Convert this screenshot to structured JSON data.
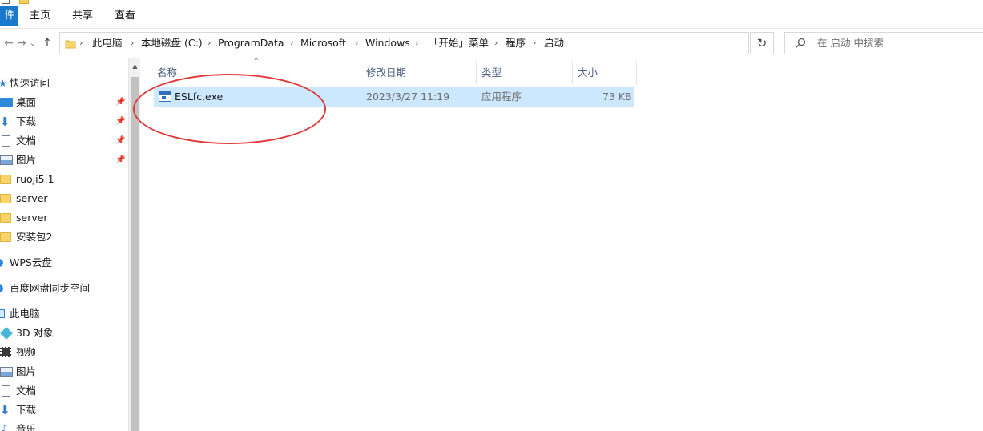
{
  "ribbon": {
    "tabs": [
      {
        "label": "件"
      },
      {
        "label": "主页"
      },
      {
        "label": "共享"
      },
      {
        "label": "查看"
      }
    ]
  },
  "nav_buttons": {
    "back": "←",
    "forward": "→",
    "recent": "⌄",
    "up": "↑"
  },
  "address": {
    "crumbs": [
      "此电脑",
      "本地磁盘 (C:)",
      "ProgramData",
      "Microsoft",
      "Windows",
      "「开始」菜单",
      "程序",
      "启动"
    ],
    "separator": "›",
    "dropdown": "⌄"
  },
  "refresh": "↻",
  "search": {
    "placeholder": "在 启动 中搜索"
  },
  "nav_pane": {
    "items": [
      {
        "label": "快速访问",
        "icon": "star-icon",
        "pinned": false
      },
      {
        "label": "桌面",
        "icon": "desktop-icon",
        "pinned": true
      },
      {
        "label": "下载",
        "icon": "download-icon",
        "pinned": true
      },
      {
        "label": "文档",
        "icon": "document-icon",
        "pinned": true
      },
      {
        "label": "图片",
        "icon": "picture-icon",
        "pinned": true
      },
      {
        "label": "ruoji5.1",
        "icon": "folder-icon",
        "pinned": false
      },
      {
        "label": "server",
        "icon": "folder-icon",
        "pinned": false
      },
      {
        "label": "server",
        "icon": "folder-icon",
        "pinned": false
      },
      {
        "label": "安装包2",
        "icon": "folder-icon",
        "pinned": false
      },
      {
        "label": "WPS云盘",
        "icon": "cloud-icon",
        "pinned": false
      },
      {
        "label": "百度网盘同步空间",
        "icon": "cloud-icon",
        "pinned": false
      },
      {
        "label": "此电脑",
        "icon": "computer-icon",
        "pinned": false
      },
      {
        "label": "3D 对象",
        "icon": "cube-icon",
        "pinned": false
      },
      {
        "label": "视频",
        "icon": "video-icon",
        "pinned": false
      },
      {
        "label": "图片",
        "icon": "picture-icon",
        "pinned": false
      },
      {
        "label": "文档",
        "icon": "document-icon",
        "pinned": false
      },
      {
        "label": "下载",
        "icon": "download-icon",
        "pinned": false
      },
      {
        "label": "音乐",
        "icon": "music-icon",
        "pinned": false
      }
    ],
    "pin_glyph": "📌"
  },
  "file_list": {
    "sort_glyph": "^",
    "columns": [
      "名称",
      "修改日期",
      "类型",
      "大小"
    ],
    "rows": [
      {
        "name": "ESLfc.exe",
        "modified": "2023/3/27 11:19",
        "type": "应用程序",
        "size": "73 KB",
        "icon": "exe-icon",
        "selected": true
      }
    ]
  },
  "colors": {
    "accent": "#1979ca",
    "selection": "#cce8ff",
    "annotation": "#e03a3a"
  }
}
